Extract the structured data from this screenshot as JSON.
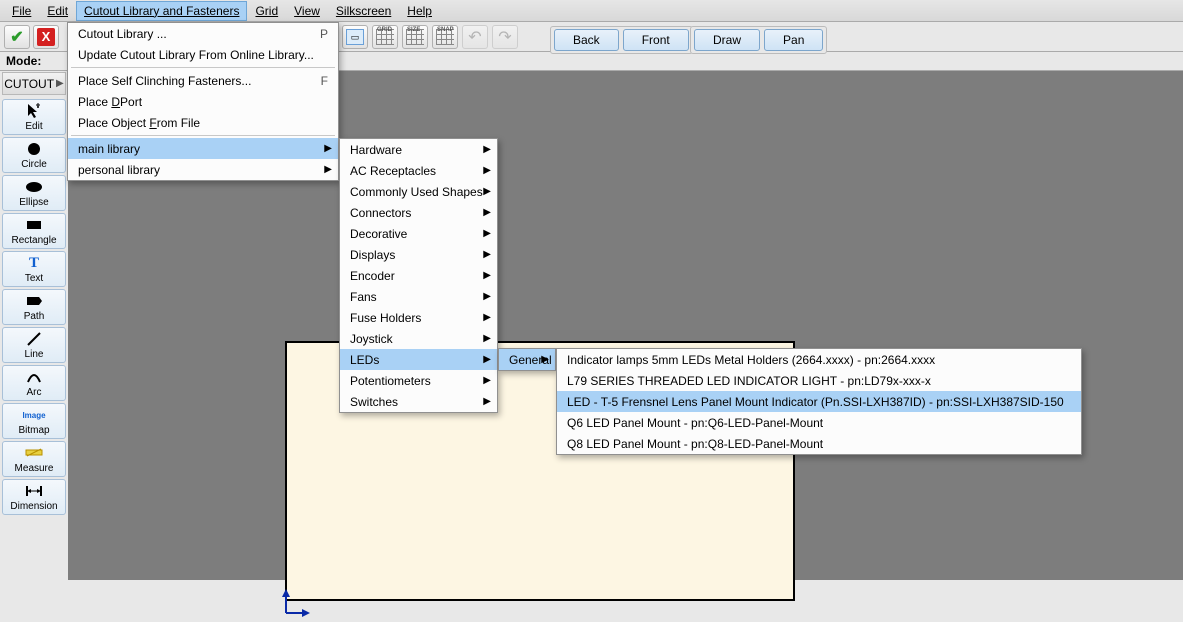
{
  "menubar": {
    "file": "File",
    "edit": "Edit",
    "cutout": "Cutout Library and Fasteners",
    "grid": "Grid",
    "view": "View",
    "silkscreen": "Silkscreen",
    "help": "Help"
  },
  "toolbar": {
    "back": "Back",
    "front": "Front",
    "draw": "Draw",
    "pan": "Pan",
    "grid_label": "GRID",
    "size_label": "SIZE",
    "snap_label": "SNAP"
  },
  "mode": {
    "label": "Mode:",
    "button": "CUTOUT"
  },
  "tools": [
    {
      "name": "Edit",
      "icon": "cursor"
    },
    {
      "name": "Circle",
      "icon": "circle"
    },
    {
      "name": "Ellipse",
      "icon": "ellipse"
    },
    {
      "name": "Rectangle",
      "icon": "rect"
    },
    {
      "name": "Text",
      "icon": "text"
    },
    {
      "name": "Path",
      "icon": "path"
    },
    {
      "name": "Line",
      "icon": "line"
    },
    {
      "name": "Arc",
      "icon": "arc"
    },
    {
      "name": "Bitmap",
      "icon": "bitmap"
    },
    {
      "name": "Measure",
      "icon": "measure"
    },
    {
      "name": "Dimension",
      "icon": "dimension"
    }
  ],
  "menu1": {
    "cutout_library": "Cutout Library ...",
    "cutout_library_key": "P",
    "update_library": "Update Cutout Library From Online Library...",
    "place_self": "Place Self Clinching Fasteners...",
    "place_self_key": "F",
    "place_dport": "Place DPort",
    "place_object": "Place Object From File",
    "main_library": "main library",
    "personal_library": "personal library"
  },
  "menu2": [
    "Hardware",
    "AC Receptacles",
    "Commonly Used Shapes",
    "Connectors",
    "Decorative",
    "Displays",
    "Encoder",
    "Fans",
    "Fuse Holders",
    "Joystick",
    "LEDs",
    "Potentiometers",
    "Switches"
  ],
  "menu3": {
    "general": "General"
  },
  "menu4": [
    "Indicator lamps 5mm LEDs Metal Holders (2664.xxxx) - pn:2664.xxxx",
    "L79 SERIES THREADED LED INDICATOR LIGHT - pn:LD79x-xxx-x",
    "LED - T-5 Frensnel Lens Panel Mount Indicator (Pn.SSI-LXH387ID) - pn:SSI-LXH387SID-150",
    "Q6 LED Panel Mount - pn:Q6-LED-Panel-Mount",
    "Q8 LED Panel Mount - pn:Q8-LED-Panel-Mount"
  ],
  "highlights": {
    "menu2_index": 10,
    "menu4_index": 2
  }
}
